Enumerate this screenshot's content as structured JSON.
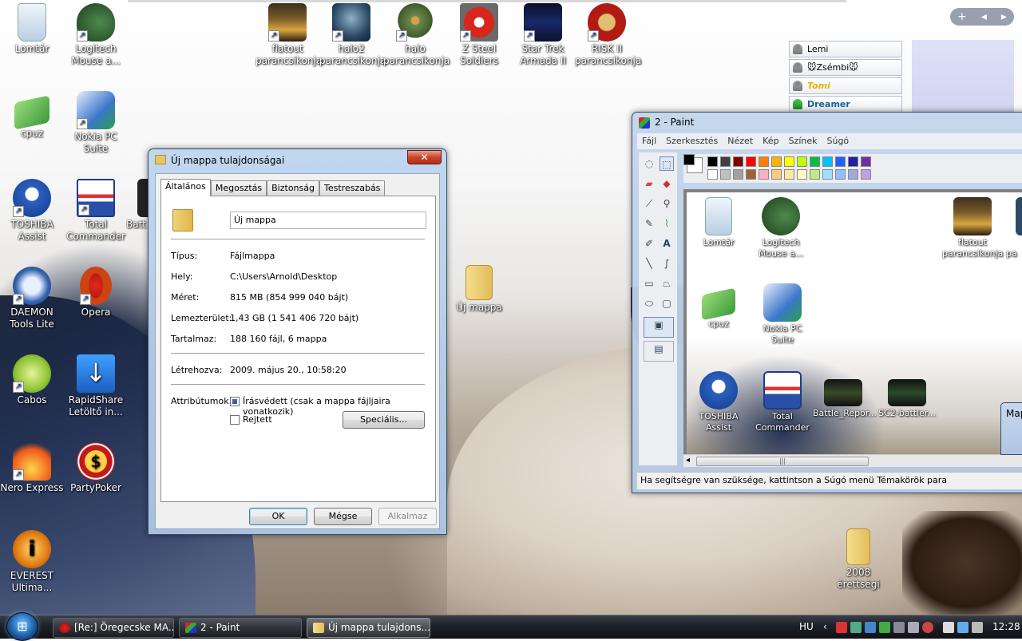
{
  "desktop_icons": [
    {
      "name": "recycle-bin",
      "label": "Lomtár"
    },
    {
      "name": "logitech",
      "label": "Logitech Mouse a..."
    },
    {
      "name": "cpuz",
      "label": "cpuz"
    },
    {
      "name": "nokia-pc-suite",
      "label": "Nokia PC Suite"
    },
    {
      "name": "toshiba-assist",
      "label": "TOSHIBA Assist"
    },
    {
      "name": "total-commander",
      "label": "Total Commander"
    },
    {
      "name": "batt-partial",
      "label": "Batt"
    },
    {
      "name": "daemon-tools",
      "label": "DAEMON Tools Lite"
    },
    {
      "name": "opera",
      "label": "Opera"
    },
    {
      "name": "cabos",
      "label": "Cabos"
    },
    {
      "name": "rapidshare",
      "label": "RapidShare Letöltő in..."
    },
    {
      "name": "nero-express",
      "label": "Nero Express"
    },
    {
      "name": "partypoker",
      "label": "PartyPoker"
    },
    {
      "name": "everest",
      "label": "EVEREST Ultima..."
    },
    {
      "name": "flatout",
      "label": "flatout parancsikonja"
    },
    {
      "name": "halo2",
      "label": "halo2 parancsikonja"
    },
    {
      "name": "halo",
      "label": "halo parancsikonja"
    },
    {
      "name": "z-steel-soldiers",
      "label": "Z Steel Soldiers"
    },
    {
      "name": "star-trek",
      "label": "Star Trek Armada II"
    },
    {
      "name": "risk2",
      "label": "RISK II parancsikonja"
    },
    {
      "name": "uj-mappa",
      "label": "Új mappa"
    },
    {
      "name": "erettsegi",
      "label": "2008 érettségi"
    }
  ],
  "contacts": [
    "Lemi",
    "🐭Zsémbi🐭",
    "Tomi",
    "Dreamer"
  ],
  "gadget_controls": {
    "add": "+",
    "prev": "◂",
    "next": "▸"
  },
  "props": {
    "title": "Új mappa tulajdonságai",
    "close": "✕",
    "tabs": [
      "Általános",
      "Megosztás",
      "Biztonság",
      "Testreszabás"
    ],
    "name_value": "Új mappa",
    "rows": [
      {
        "label": "Típus:",
        "value": "Fájlmappa"
      },
      {
        "label": "Hely:",
        "value": "C:\\Users\\Arnold\\Desktop"
      },
      {
        "label": "Méret:",
        "value": "815 MB (854 999 040 bájt)"
      },
      {
        "label": "Lemezterület:",
        "value": "1,43 GB (1 541 406 720 bájt)"
      },
      {
        "label": "Tartalmaz:",
        "value": "188 160 fájl, 6 mappa"
      }
    ],
    "created_label": "Létrehozva:",
    "created_value": "2009. május 20., 10:58:20",
    "attr_label": "Attribútumok:",
    "readonly_label": "Írásvédett (csak a mappa fájljaira vonatkozik)",
    "hidden_label": "Rejtett",
    "special_button": "Speciális...",
    "ok": "OK",
    "cancel": "Mégse",
    "apply": "Alkalmaz"
  },
  "paint": {
    "title": "2 - Paint",
    "menu": [
      "Fájl",
      "Szerkesztés",
      "Nézet",
      "Kép",
      "Színek",
      "Súgó"
    ],
    "status": "Ha segítségre van szüksége, kattintson a Súgó menü Témakörök para",
    "scroll_left": "◂",
    "scroll_thumb": "|||",
    "palette_top": [
      "#000000",
      "#404040",
      "#7f0000",
      "#ff0000",
      "#ff7f00",
      "#ffb200",
      "#ffff00",
      "#bfff00",
      "#00c040",
      "#00c0ff",
      "#2060ff",
      "#2020a0",
      "#7030a0"
    ],
    "palette_bottom": [
      "#ffffff",
      "#c0c0c0",
      "#a0a0a0",
      "#a06030",
      "#ffb0c0",
      "#ffc880",
      "#ffe8a0",
      "#ffffc0",
      "#c0e880",
      "#a0e0ff",
      "#90c0ff",
      "#a0a8e0",
      "#c0a0e0"
    ],
    "canvas_icons": [
      {
        "label": "Lomtár"
      },
      {
        "label": "Logitech Mouse a..."
      },
      {
        "label": "flatout parancsikonja"
      },
      {
        "label": "pa"
      },
      {
        "label": "cpuz"
      },
      {
        "label": "Nokia PC Suite"
      },
      {
        "label": "TOSHIBA Assist"
      },
      {
        "label": "Total Commander"
      },
      {
        "label": "Battle_Repor..."
      },
      {
        "label": "SC2-battler..."
      }
    ],
    "side_window_title": "Map"
  },
  "taskbar": {
    "start": "⊞",
    "buttons": [
      {
        "label": "[Re:] Öregecske MA..."
      },
      {
        "label": "2 - Paint"
      },
      {
        "label": "Új mappa tulajdons..."
      }
    ],
    "lang": "HU",
    "expand": "‹",
    "clock": "12:28"
  }
}
